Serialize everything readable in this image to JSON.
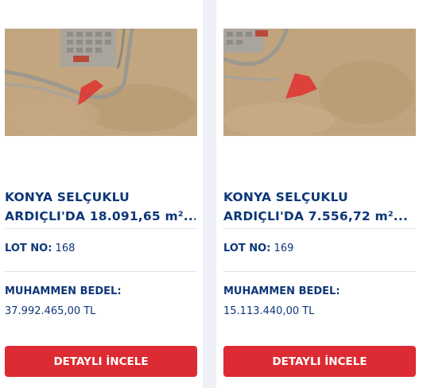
{
  "listings": [
    {
      "title_line1": "KONYA SELÇUKLU",
      "title_line2": "ARDIÇLI'DA 18.091,65 m²...",
      "lot_label": "LOT NO:",
      "lot_value": "168",
      "price_label": "MUHAMMEN BEDEL:",
      "price_value": "37.992.465,00 TL",
      "button_label": "DETAYLI İNCELE"
    },
    {
      "title_line1": "KONYA SELÇUKLU",
      "title_line2": "ARDIÇLI'DA 7.556,72 m²...",
      "lot_label": "LOT NO:",
      "lot_value": "169",
      "price_label": "MUHAMMEN BEDEL:",
      "price_value": "15.113.440,00 TL",
      "button_label": "DETAYLI İNCELE"
    }
  ],
  "colors": {
    "title": "#0d3778",
    "button": "#dc2b33",
    "parcel": "#e0302f",
    "background": "#eef1f6"
  },
  "icons": [
    "satellite-parcel-image"
  ]
}
